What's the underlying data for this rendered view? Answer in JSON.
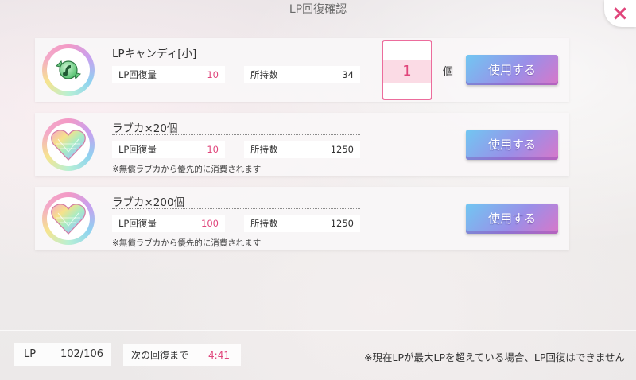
{
  "window": {
    "title": "LP回復確認"
  },
  "colors": {
    "accent": "#e0457b",
    "button_start": "#71c7f2",
    "button_end": "#d877c9"
  },
  "items": [
    {
      "name": "LPキャンディ[小]",
      "icon": "candy-icon",
      "stat_recover_label": "LP回復量",
      "stat_recover_value": "10",
      "stat_owned_label": "所持数",
      "stat_owned_value": "34",
      "note": "",
      "quantity": "1",
      "quantity_unit": "個",
      "button_label": "使用する"
    },
    {
      "name": "ラブカ×20個",
      "icon": "rainbow-heart-icon",
      "stat_recover_label": "LP回復量",
      "stat_recover_value": "10",
      "stat_owned_label": "所持数",
      "stat_owned_value": "1250",
      "note": "※無償ラブカから優先的に消費されます",
      "button_label": "使用する"
    },
    {
      "name": "ラブカ×200個",
      "icon": "rainbow-heart-icon",
      "stat_recover_label": "LP回復量",
      "stat_recover_value": "100",
      "stat_owned_label": "所持数",
      "stat_owned_value": "1250",
      "note": "※無償ラブカから優先的に消費されます",
      "button_label": "使用する"
    }
  ],
  "footer": {
    "lp_label": "LP",
    "lp_value": "102/106",
    "next_label": "次の回復まで",
    "next_value": "4:41",
    "note": "※現在LPが最大LPを超えている場合、LP回復はできません"
  },
  "close_label": "×"
}
